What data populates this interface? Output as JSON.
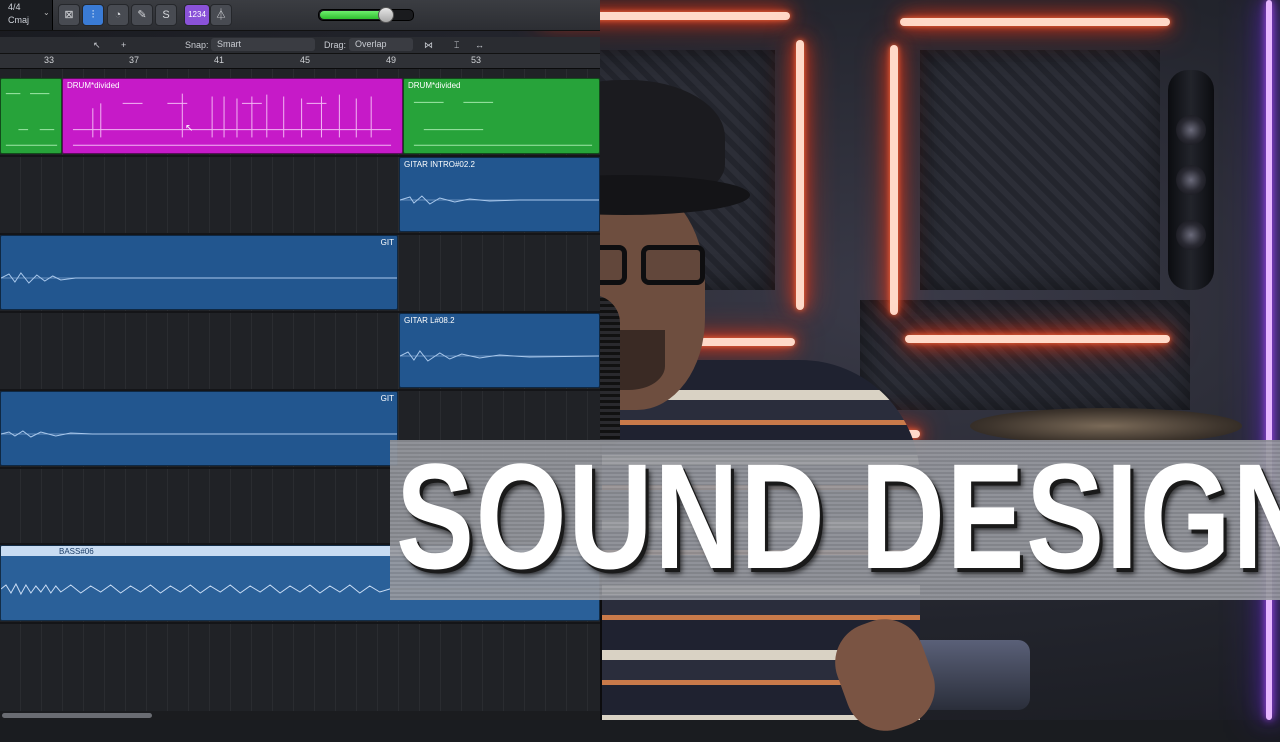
{
  "toolbar": {
    "time_signature": "4/4",
    "key": "Cmaj",
    "buttons": [
      {
        "icon": "shield-x-icon",
        "glyph": "⊠"
      },
      {
        "icon": "mixer-icon",
        "glyph": "⫶"
      },
      {
        "icon": "gauge-icon",
        "glyph": "◔"
      },
      {
        "icon": "pencil-icon",
        "glyph": "✎"
      },
      {
        "icon": "score-icon",
        "glyph": "S"
      }
    ],
    "count_in_label": "1234",
    "metronome_glyph": "⏃",
    "master_volume_fraction": 0.7
  },
  "edit_bar": {
    "pointer_glyph": "↖",
    "crosshair_glyph": "+",
    "snap_label": "Snap:",
    "snap_value": "Smart",
    "drag_label": "Drag:",
    "drag_value": "Overlap"
  },
  "ruler": {
    "bars": [
      "33",
      "37",
      "41",
      "45",
      "49",
      "53"
    ]
  },
  "regions": {
    "drum_main": "DRUM*divided",
    "drum_right": "DRUM*divided",
    "gitar_intro": "GITAR INTRO#02.2",
    "git_1": "GIT",
    "gitar_l": "GITAR L#08.2",
    "git_2": "GIT",
    "bass": "BASS#06"
  },
  "title": {
    "text": "SOUND DESIGN"
  },
  "colors": {
    "drum_green": "#27a33a",
    "drum_pink": "#c61ac8",
    "audio_blue": "#22568f",
    "neon": "#ff3a1a"
  }
}
